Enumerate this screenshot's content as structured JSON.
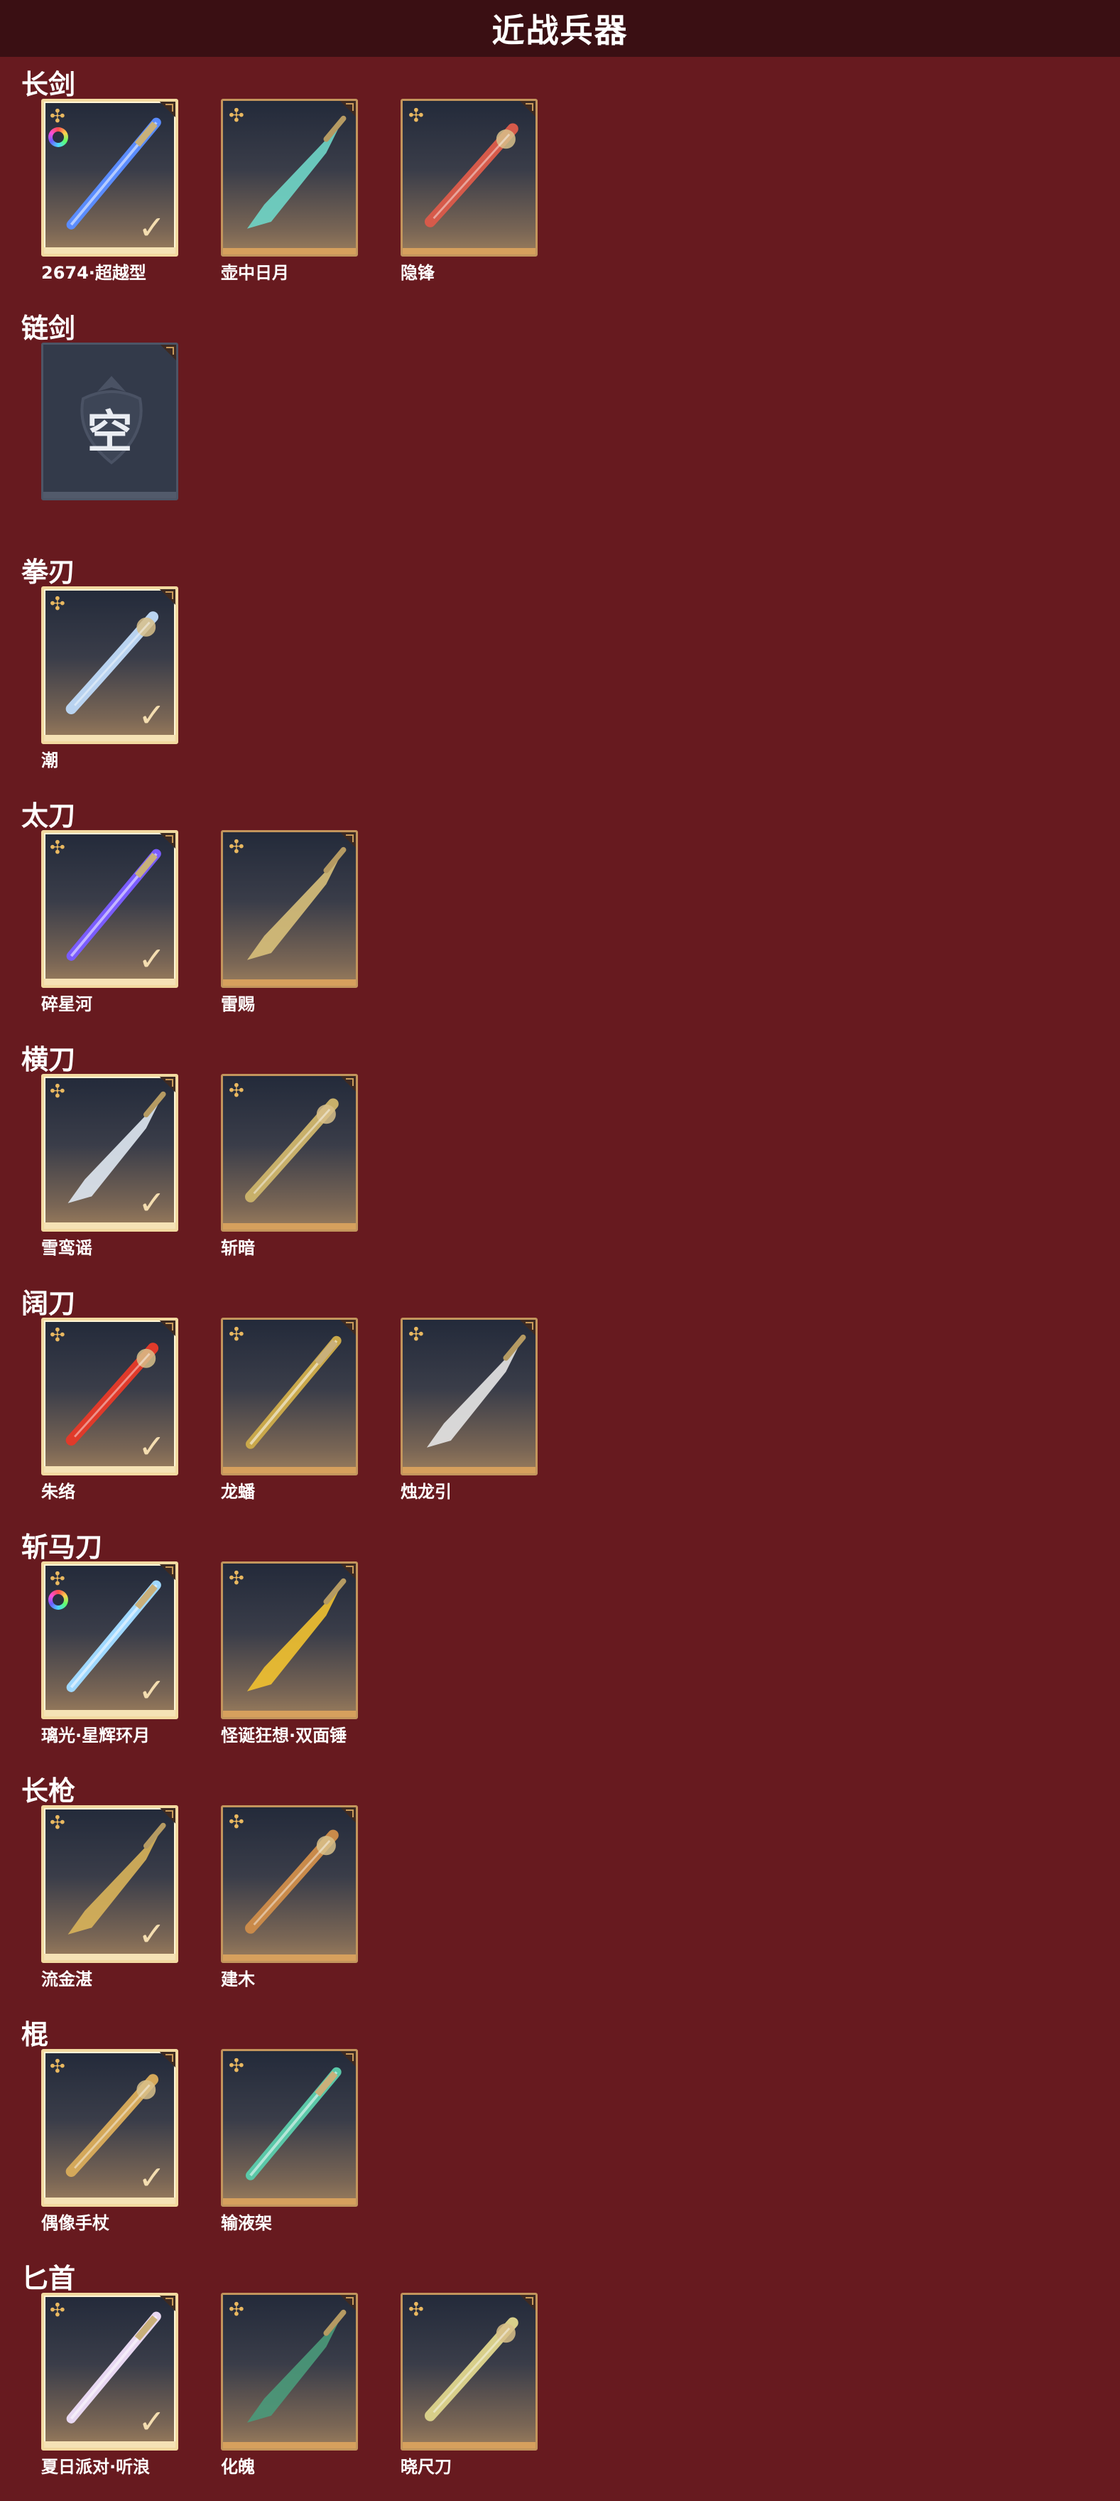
{
  "header": {
    "title": "近战兵器"
  },
  "sections": [
    {
      "category": "长剑",
      "items": [
        {
          "name": "2674·超越型",
          "selected": true,
          "dye": true,
          "color": "#5a8cff"
        },
        {
          "name": "壶中日月",
          "selected": false,
          "dye": false,
          "color": "#6fd6c8"
        },
        {
          "name": "隐锋",
          "selected": false,
          "dye": false,
          "color": "#d65a4a"
        }
      ]
    },
    {
      "category": "链剑",
      "items": [
        {
          "name": "",
          "empty": true,
          "empty_text": "空"
        }
      ]
    },
    {
      "category": "拳刃",
      "items": [
        {
          "name": "潮",
          "selected": true,
          "dye": false,
          "color": "#b9d3f0"
        }
      ]
    },
    {
      "category": "太刀",
      "items": [
        {
          "name": "碎星河",
          "selected": true,
          "dye": false,
          "color": "#7a5cff"
        },
        {
          "name": "雷赐",
          "selected": false,
          "dye": false,
          "color": "#d8c07a"
        }
      ]
    },
    {
      "category": "横刀",
      "items": [
        {
          "name": "雪鸾谣",
          "selected": true,
          "dye": false,
          "color": "#dfe8f2"
        },
        {
          "name": "斩暗",
          "selected": false,
          "dye": false,
          "color": "#c8b06a"
        }
      ]
    },
    {
      "category": "阔刀",
      "items": [
        {
          "name": "朱络",
          "selected": true,
          "dye": false,
          "color": "#e03a2a"
        },
        {
          "name": "龙蟠",
          "selected": false,
          "dye": false,
          "color": "#c9a84a"
        },
        {
          "name": "烛龙引",
          "selected": false,
          "dye": false,
          "color": "#e6e6e6"
        }
      ]
    },
    {
      "category": "斩马刀",
      "items": [
        {
          "name": "璃光·星辉环月",
          "selected": true,
          "dye": true,
          "color": "#9fd8ff"
        },
        {
          "name": "怪诞狂想·双面锤",
          "selected": false,
          "dye": false,
          "color": "#f2c230"
        }
      ]
    },
    {
      "category": "长枪",
      "items": [
        {
          "name": "流金湛",
          "selected": true,
          "dye": false,
          "color": "#d9b45a"
        },
        {
          "name": "建木",
          "selected": false,
          "dye": false,
          "color": "#c98a4a"
        }
      ]
    },
    {
      "category": "棍",
      "items": [
        {
          "name": "偶像手杖",
          "selected": true,
          "dye": false,
          "color": "#d4a85a"
        },
        {
          "name": "输液架",
          "selected": false,
          "dye": false,
          "color": "#5ac8a8"
        }
      ]
    },
    {
      "category": "匕首",
      "items": [
        {
          "name": "夏日派对·听浪",
          "selected": true,
          "dye": false,
          "color": "#e8d8f2"
        },
        {
          "name": "化魄",
          "selected": false,
          "dye": false,
          "color": "#4a9a7a"
        },
        {
          "name": "晓尺刀",
          "selected": false,
          "dye": false,
          "color": "#d8cf8a"
        }
      ]
    }
  ],
  "icons": {
    "rarity": "rarity-flower-icon",
    "check": "check-icon",
    "dye": "dye-palette-icon",
    "corner": "corner-fold-icon"
  }
}
